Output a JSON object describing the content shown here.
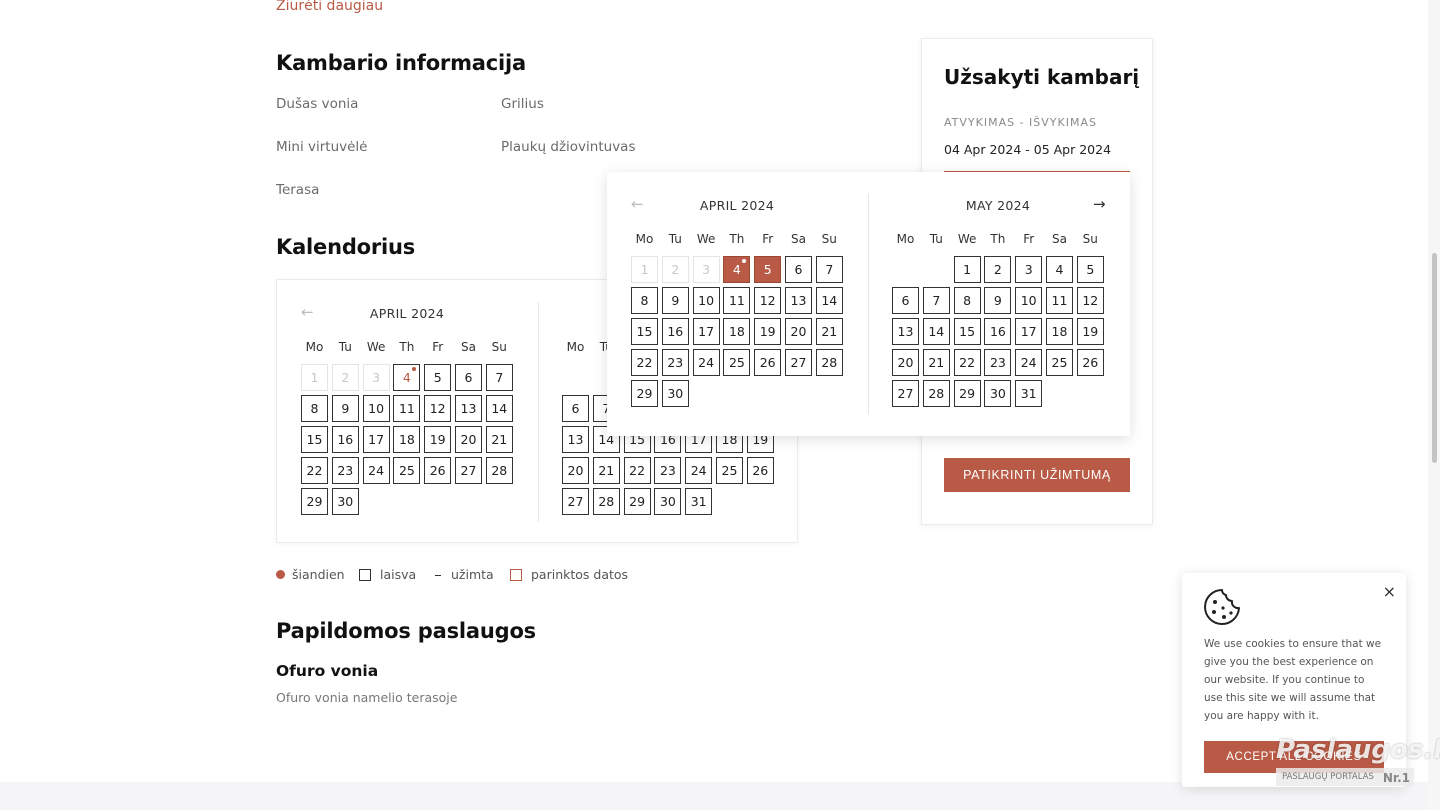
{
  "more_link": "Žiūrėti daugiau",
  "room_info": {
    "title": "Kambario informacija",
    "amenities": [
      "Dušas vonia",
      "Grilius",
      "Mini virtuvėlė",
      "Plaukų džiovintuvas",
      "Terasa"
    ]
  },
  "calendar": {
    "title": "Kalendorius",
    "weekdays": [
      "Mo",
      "Tu",
      "We",
      "Th",
      "Fr",
      "Sa",
      "Su"
    ],
    "april_title": "APRIL 2024",
    "may_title": "MAY 2024",
    "prev_arrow": "←",
    "next_arrow": "→"
  },
  "legend": {
    "today": "šiandien",
    "free": "laisva",
    "booked": "užimta",
    "selected": "parinktos datos"
  },
  "booking": {
    "title": "Užsakyti kambarį",
    "label": "ATVYKIMAS - IŠVYKIMAS",
    "date_range": "04 Apr 2024 - 05 Apr 2024",
    "check_button": "PATIKRINTI UŽIMTUMĄ"
  },
  "services": {
    "title": "Papildomos paslaugos",
    "item_title": "Ofuro vonia",
    "item_desc": "Ofuro vonia namelio terasoje"
  },
  "cookie": {
    "close": "×",
    "text": "We use cookies to ensure that we give you the best experience on our website. If you continue to use this site we will assume that you are happy with it.",
    "button": "ACCEPT ALL COOKIES"
  },
  "watermark": {
    "brand": "Paslaugos.lt",
    "sub": "PASLAUGŲ PORTALAS",
    "nr": "Nr.1"
  },
  "colors": {
    "accent": "#b85a45"
  },
  "icons": [
    "arrow-left-icon",
    "arrow-right-icon",
    "cookie-icon",
    "close-icon"
  ]
}
